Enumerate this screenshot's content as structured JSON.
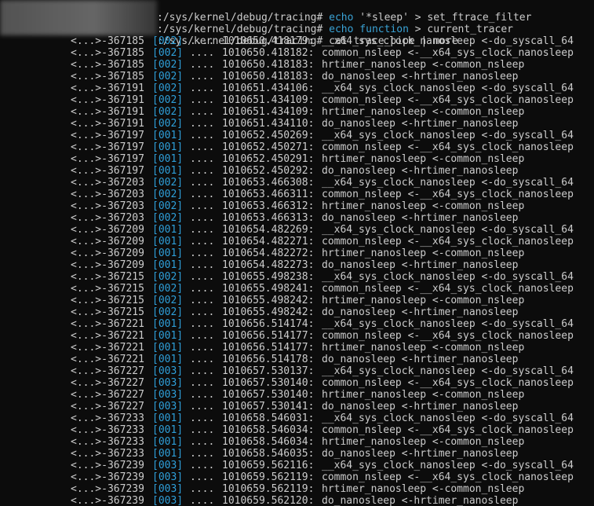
{
  "terminal": {
    "commands": [
      {
        "prefix": ":/sys/kernel/debug/tracing# ",
        "keyword": "echo",
        "rest": " '*sleep' > set_ftrace_filter"
      },
      {
        "prefix": ":/sys/kernel/debug/tracing# ",
        "keyword": "echo",
        "middle": " ",
        "keyword2": "function",
        "rest": " > current_tracer"
      },
      {
        "prefix": ":/sys/kernel/debug/tracing# ",
        "keyword": "",
        "rest": "cat trace_pipe | more"
      }
    ],
    "trace_lines": [
      {
        "task": "<...>-367185",
        "cpu": "[002]",
        "flags": "....",
        "ts": "1010650.418179:",
        "func": "__x64_sys_clock_nanosleep <-do_syscall_64"
      },
      {
        "task": "<...>-367185",
        "cpu": "[002]",
        "flags": "....",
        "ts": "1010650.418182:",
        "func": "common_nsleep <-__x64_sys_clock_nanosleep"
      },
      {
        "task": "<...>-367185",
        "cpu": "[002]",
        "flags": "....",
        "ts": "1010650.418183:",
        "func": "hrtimer_nanosleep <-common_nsleep"
      },
      {
        "task": "<...>-367185",
        "cpu": "[002]",
        "flags": "....",
        "ts": "1010650.418183:",
        "func": "do_nanosleep <-hrtimer_nanosleep"
      },
      {
        "task": "<...>-367191",
        "cpu": "[002]",
        "flags": "....",
        "ts": "1010651.434106:",
        "func": "__x64_sys_clock_nanosleep <-do_syscall_64"
      },
      {
        "task": "<...>-367191",
        "cpu": "[002]",
        "flags": "....",
        "ts": "1010651.434109:",
        "func": "common_nsleep <-__x64_sys_clock_nanosleep"
      },
      {
        "task": "<...>-367191",
        "cpu": "[002]",
        "flags": "....",
        "ts": "1010651.434109:",
        "func": "hrtimer_nanosleep <-common_nsleep"
      },
      {
        "task": "<...>-367191",
        "cpu": "[002]",
        "flags": "....",
        "ts": "1010651.434110:",
        "func": "do_nanosleep <-hrtimer_nanosleep"
      },
      {
        "task": "<...>-367197",
        "cpu": "[001]",
        "flags": "....",
        "ts": "1010652.450269:",
        "func": "__x64_sys_clock_nanosleep <-do_syscall_64"
      },
      {
        "task": "<...>-367197",
        "cpu": "[001]",
        "flags": "....",
        "ts": "1010652.450271:",
        "func": "common_nsleep <-__x64_sys_clock_nanosleep"
      },
      {
        "task": "<...>-367197",
        "cpu": "[001]",
        "flags": "....",
        "ts": "1010652.450291:",
        "func": "hrtimer_nanosleep <-common_nsleep"
      },
      {
        "task": "<...>-367197",
        "cpu": "[001]",
        "flags": "....",
        "ts": "1010652.450292:",
        "func": "do_nanosleep <-hrtimer_nanosleep"
      },
      {
        "task": "<...>-367203",
        "cpu": "[002]",
        "flags": "....",
        "ts": "1010653.466308:",
        "func": "__x64_sys_clock_nanosleep <-do_syscall_64"
      },
      {
        "task": "<...>-367203",
        "cpu": "[002]",
        "flags": "....",
        "ts": "1010653.466311:",
        "func": "common_nsleep <-__x64_sys_clock_nanosleep"
      },
      {
        "task": "<...>-367203",
        "cpu": "[002]",
        "flags": "....",
        "ts": "1010653.466312:",
        "func": "hrtimer_nanosleep <-common_nsleep"
      },
      {
        "task": "<...>-367203",
        "cpu": "[002]",
        "flags": "....",
        "ts": "1010653.466313:",
        "func": "do_nanosleep <-hrtimer_nanosleep"
      },
      {
        "task": "<...>-367209",
        "cpu": "[001]",
        "flags": "....",
        "ts": "1010654.482269:",
        "func": "__x64_sys_clock_nanosleep <-do_syscall_64"
      },
      {
        "task": "<...>-367209",
        "cpu": "[001]",
        "flags": "....",
        "ts": "1010654.482271:",
        "func": "common_nsleep <-__x64_sys_clock_nanosleep"
      },
      {
        "task": "<...>-367209",
        "cpu": "[001]",
        "flags": "....",
        "ts": "1010654.482272:",
        "func": "hrtimer_nanosleep <-common_nsleep"
      },
      {
        "task": "<...>-367209",
        "cpu": "[001]",
        "flags": "....",
        "ts": "1010654.482273:",
        "func": "do_nanosleep <-hrtimer_nanosleep"
      },
      {
        "task": "<...>-367215",
        "cpu": "[002]",
        "flags": "....",
        "ts": "1010655.498238:",
        "func": "__x64_sys_clock_nanosleep <-do_syscall_64"
      },
      {
        "task": "<...>-367215",
        "cpu": "[002]",
        "flags": "....",
        "ts": "1010655.498241:",
        "func": "common_nsleep <-__x64_sys_clock_nanosleep"
      },
      {
        "task": "<...>-367215",
        "cpu": "[002]",
        "flags": "....",
        "ts": "1010655.498242:",
        "func": "hrtimer_nanosleep <-common_nsleep"
      },
      {
        "task": "<...>-367215",
        "cpu": "[002]",
        "flags": "....",
        "ts": "1010655.498242:",
        "func": "do_nanosleep <-hrtimer_nanosleep"
      },
      {
        "task": "<...>-367221",
        "cpu": "[001]",
        "flags": "....",
        "ts": "1010656.514174:",
        "func": "__x64_sys_clock_nanosleep <-do_syscall_64"
      },
      {
        "task": "<...>-367221",
        "cpu": "[001]",
        "flags": "....",
        "ts": "1010656.514177:",
        "func": "common_nsleep <-__x64_sys_clock_nanosleep"
      },
      {
        "task": "<...>-367221",
        "cpu": "[001]",
        "flags": "....",
        "ts": "1010656.514177:",
        "func": "hrtimer_nanosleep <-common_nsleep"
      },
      {
        "task": "<...>-367221",
        "cpu": "[001]",
        "flags": "....",
        "ts": "1010656.514178:",
        "func": "do_nanosleep <-hrtimer_nanosleep"
      },
      {
        "task": "<...>-367227",
        "cpu": "[003]",
        "flags": "....",
        "ts": "1010657.530137:",
        "func": "__x64_sys_clock_nanosleep <-do_syscall_64"
      },
      {
        "task": "<...>-367227",
        "cpu": "[003]",
        "flags": "....",
        "ts": "1010657.530140:",
        "func": "common_nsleep <-__x64_sys_clock_nanosleep"
      },
      {
        "task": "<...>-367227",
        "cpu": "[003]",
        "flags": "....",
        "ts": "1010657.530140:",
        "func": "hrtimer_nanosleep <-common_nsleep"
      },
      {
        "task": "<...>-367227",
        "cpu": "[003]",
        "flags": "....",
        "ts": "1010657.530141:",
        "func": "do_nanosleep <-hrtimer_nanosleep"
      },
      {
        "task": "<...>-367233",
        "cpu": "[001]",
        "flags": "....",
        "ts": "1010658.546031:",
        "func": "__x64_sys_clock_nanosleep <-do_syscall_64"
      },
      {
        "task": "<...>-367233",
        "cpu": "[001]",
        "flags": "....",
        "ts": "1010658.546034:",
        "func": "common_nsleep <-__x64_sys_clock_nanosleep"
      },
      {
        "task": "<...>-367233",
        "cpu": "[001]",
        "flags": "....",
        "ts": "1010658.546034:",
        "func": "hrtimer_nanosleep <-common_nsleep"
      },
      {
        "task": "<...>-367233",
        "cpu": "[001]",
        "flags": "....",
        "ts": "1010658.546035:",
        "func": "do_nanosleep <-hrtimer_nanosleep"
      },
      {
        "task": "<...>-367239",
        "cpu": "[003]",
        "flags": "....",
        "ts": "1010659.562116:",
        "func": "__x64_sys_clock_nanosleep <-do_syscall_64"
      },
      {
        "task": "<...>-367239",
        "cpu": "[003]",
        "flags": "....",
        "ts": "1010659.562119:",
        "func": "common_nsleep <-__x64_sys_clock_nanosleep"
      },
      {
        "task": "<...>-367239",
        "cpu": "[003]",
        "flags": "....",
        "ts": "1010659.562119:",
        "func": "hrtimer_nanosleep <-common_nsleep"
      },
      {
        "task": "<...>-367239",
        "cpu": "[003]",
        "flags": "....",
        "ts": "1010659.562120:",
        "func": "do_nanosleep <-hrtimer_nanosleep"
      }
    ]
  },
  "colors": {
    "background": "#0c0c0c",
    "text": "#cccccc",
    "keyword": "#3aa3d6",
    "cpu": "#2e9fd9"
  }
}
